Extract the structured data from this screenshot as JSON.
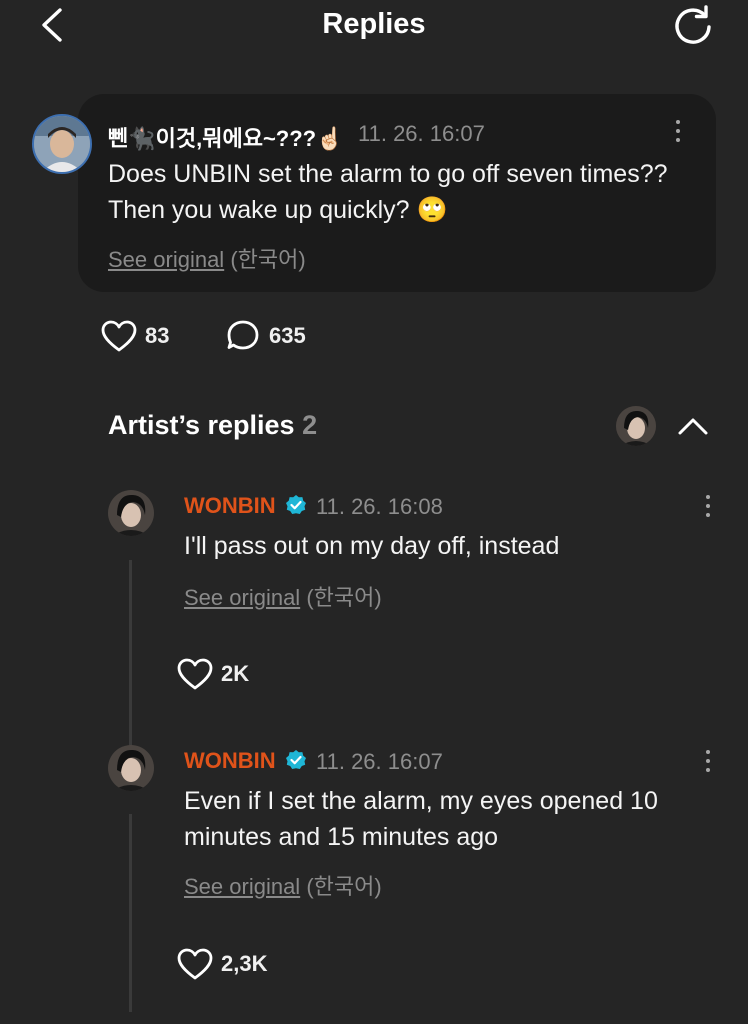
{
  "header": {
    "title": "Replies",
    "back_icon": "chevron-left-icon",
    "refresh_icon": "refresh-icon"
  },
  "post": {
    "author": "뻰🐈‍⬛이것,뭐에요~???☝🏻",
    "timestamp": "11. 26. 16:07",
    "text": "Does UNBIN set the alarm to go off seven times??Then you wake up quickly? 🙄",
    "see_original": "See original",
    "original_language": "(한국어)",
    "likes": "83",
    "comments": "635"
  },
  "artist_replies": {
    "title": "Artist’s replies",
    "count": "2",
    "collapse_icon": "chevron-up-icon"
  },
  "replies": [
    {
      "author": "WONBIN",
      "timestamp": "11. 26. 16:08",
      "text": "I'll pass out on my day off, instead",
      "see_original": "See original",
      "original_language": "(한국어)",
      "likes": "2K"
    },
    {
      "author": "WONBIN",
      "timestamp": "11. 26. 16:07",
      "text": "Even if I set the alarm, my eyes opened 10 minutes and 15 minutes ago",
      "see_original": "See original",
      "original_language": "(한국어)",
      "likes": "2,3K"
    }
  ],
  "colors": {
    "background": "#252525",
    "card": "#1b1b1b",
    "artist_name": "#e0531a",
    "verified_badge": "#1fb6d6",
    "muted_text": "#8e8e8e"
  }
}
